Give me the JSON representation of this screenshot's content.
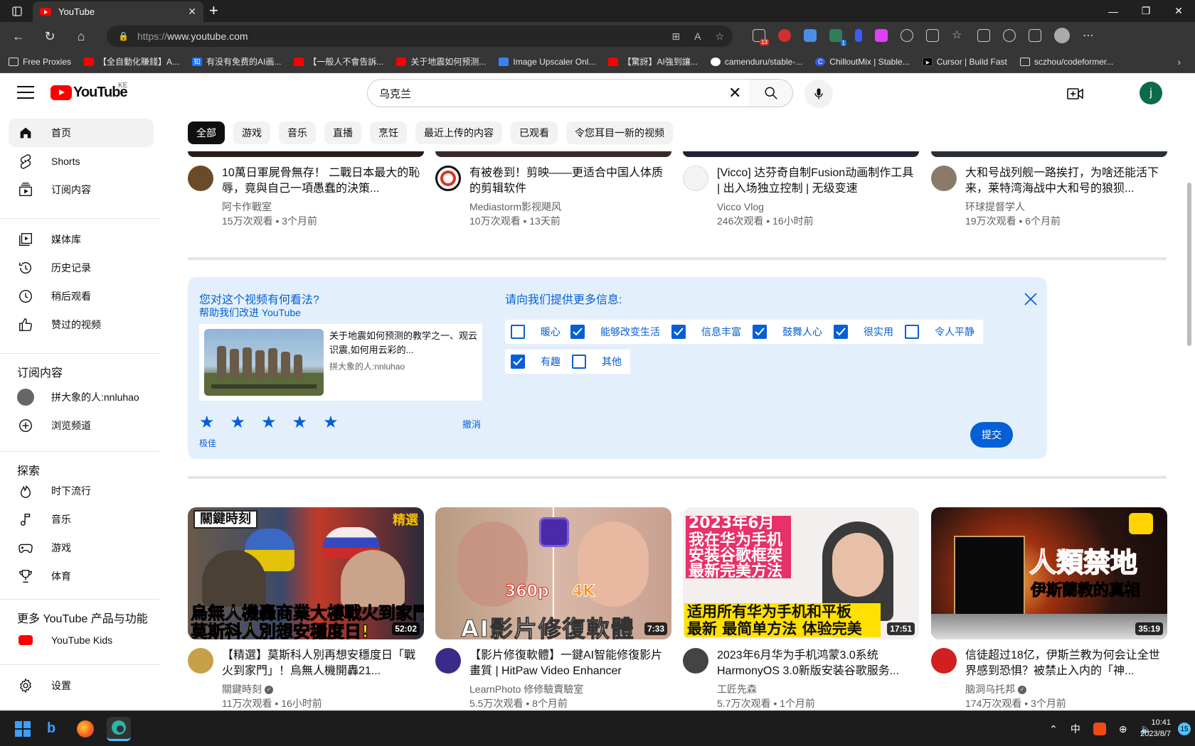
{
  "browser": {
    "tab_title": "YouTube",
    "url_proto": "https://",
    "url_host": "www.youtube.com",
    "bookmarks": [
      {
        "label": "Free Proxies",
        "icon": "document-icon",
        "color": "#ffffff"
      },
      {
        "label": "【全自動化賺錢】A...",
        "icon": "youtube-icon",
        "color": "#ff0000"
      },
      {
        "label": "有没有免费的AI画...",
        "icon": "zhihu-icon",
        "color": "#1772f6"
      },
      {
        "label": "【一般人不會告訴...",
        "icon": "youtube-icon",
        "color": "#ff0000"
      },
      {
        "label": "关于地震如何预测...",
        "icon": "youtube-icon",
        "color": "#ff0000"
      },
      {
        "label": "Image Upscaler Onl...",
        "icon": "upscaler-icon",
        "color": "#3b82f6"
      },
      {
        "label": "【驚訝】AI強到讓...",
        "icon": "youtube-icon",
        "color": "#ff0000"
      },
      {
        "label": "camenduru/stable-...",
        "icon": "github-icon",
        "color": "#ffffff"
      },
      {
        "label": "ChilloutMix | Stable...",
        "icon": "civitai-icon",
        "color": "#3b5bdb"
      },
      {
        "label": "Cursor | Build Fast",
        "icon": "cursor-icon",
        "color": "#000000"
      },
      {
        "label": "sczhou/codeformer...",
        "icon": "replicate-icon",
        "color": "#ffffff"
      }
    ]
  },
  "youtube": {
    "logo_text": "YouTube",
    "region": "KE",
    "search_value": "乌克兰",
    "user_initial": "j",
    "sidebar": {
      "main": [
        {
          "label": "首页",
          "icon": "home-icon"
        },
        {
          "label": "Shorts",
          "icon": "shorts-icon"
        },
        {
          "label": "订阅内容",
          "icon": "subscriptions-icon"
        }
      ],
      "library": [
        {
          "label": "媒体库",
          "icon": "library-icon"
        },
        {
          "label": "历史记录",
          "icon": "history-icon"
        },
        {
          "label": "稍后观看",
          "icon": "watch-later-icon"
        },
        {
          "label": "赞过的视频",
          "icon": "liked-icon"
        }
      ],
      "subs_heading": "订阅内容",
      "subs": [
        {
          "label": "拼大象的人:nnluhao",
          "icon": "channel-avatar"
        },
        {
          "label": "浏览频道",
          "icon": "browse-channels-icon"
        }
      ],
      "explore_heading": "探索",
      "explore": [
        {
          "label": "时下流行",
          "icon": "trending-icon"
        },
        {
          "label": "音乐",
          "icon": "music-icon"
        },
        {
          "label": "游戏",
          "icon": "gaming-icon"
        },
        {
          "label": "体育",
          "icon": "sports-icon"
        }
      ],
      "more_heading": "更多 YouTube 产品与功能",
      "more": [
        {
          "label": "YouTube Kids",
          "icon": "youtube-kids-icon"
        }
      ],
      "settings": "设置"
    },
    "chips": [
      "全部",
      "游戏",
      "音乐",
      "直播",
      "烹饪",
      "最近上传的内容",
      "已观看",
      "令您耳目一新的视频"
    ],
    "row1": [
      {
        "title": "10萬日軍屍骨無存！ 二戰日本最大的恥辱，竟與自己一項愚蠢的決策...",
        "channel": "阿卡作戰室",
        "stats": "15万次观看 • 3个月前",
        "avatar_color": "#6b4a2a"
      },
      {
        "title": "有被卷到！剪映——更适合中国人体质的剪辑软件",
        "channel": "Mediastorm影视飓风",
        "stats": "10万次观看 • 13天前",
        "avatar_color": "#ffffff"
      },
      {
        "title": "[Vicco] 达芬奇自制Fusion动画制作工具 | 出入场独立控制 | 无级变速",
        "channel": "Vicco Vlog",
        "stats": "246次观看 • 16小时前",
        "avatar_color": "#f3f3f3"
      },
      {
        "title": "大和号战列舰一路挨打，为啥还能活下来，莱特湾海战中大和号的狼狈...",
        "channel": "环球提督学人",
        "stats": "19万次观看 • 6个月前",
        "avatar_color": "#8a7a6a"
      }
    ],
    "survey": {
      "question": "您对这个视频有何看法?",
      "help": "帮助我们改进 YouTube",
      "video_title": "关于地震如何预测的教学之一、观云识震,如何用云彩的...",
      "video_channel": "拼大象的人:nnluhao",
      "rating": 5,
      "rating_label": "极佳",
      "undo": "撤消",
      "more_info": "请向我们提供更多信息:",
      "options": [
        {
          "label": "暖心",
          "checked": false
        },
        {
          "label": "能够改变生活",
          "checked": true
        },
        {
          "label": "信息丰富",
          "checked": true
        },
        {
          "label": "鼓舞人心",
          "checked": true
        },
        {
          "label": "很实用",
          "checked": true
        },
        {
          "label": "令人平静",
          "checked": false
        },
        {
          "label": "有趣",
          "checked": true
        },
        {
          "label": "其他",
          "checked": false
        }
      ],
      "submit": "提交"
    },
    "row2": [
      {
        "title": "【精選】莫斯科人別再想安穩度日「戰火到家門」！烏無人機開轟21...",
        "channel": "關鍵時刻",
        "verified": true,
        "stats": "11万次观看 • 16小时前",
        "duration": "52:02",
        "cap1": "烏無人機轟商業大樓",
        "cap1b": "戰火到家門",
        "cap2": "莫斯科人別想安穩度日!",
        "badge": "精選",
        "brand": "關鍵時刻",
        "avatar_color": "#c8a04a"
      },
      {
        "title": "【影片修復軟體】一鍵AI智能修復影片畫質 | HitPaw Video Enhancer",
        "channel": "LearnPhoto 修修驗賣驗室",
        "verified": false,
        "stats": "5.5万次观看 • 8个月前",
        "duration": "7:33",
        "cap1": "AI影片修復軟體",
        "res_from": "360p",
        "res_to": "4K",
        "avatar_color": "#3b2a8a"
      },
      {
        "title": "2023年6月华为手机鸿蒙3.0系统HarmonyOS 3.0新版安装谷歌服务...",
        "channel": "工匠先森",
        "verified": false,
        "stats": "5.7万次观看 • 1个月前",
        "duration": "17:51",
        "cap1": "2023年6月",
        "cap2": "我在华为手机",
        "cap3": "安装谷歌框架",
        "cap4": "最新完美方法",
        "cap5": "适用所有华为手机和平板",
        "cap6": "最新 最简单方法 体验完美",
        "avatar_color": "#444444"
      },
      {
        "title": "信徒超过18亿，伊斯兰教为何会让全世界感到恐惧？被禁止入内的「神...",
        "channel": "脑洞乌托邦",
        "verified": true,
        "stats": "174万次观看 • 3个月前",
        "duration": "35:19",
        "cap1": "人類禁地",
        "cap2": "伊斯蘭教的真相",
        "avatar_color": "#d02020"
      }
    ]
  },
  "taskbar": {
    "ime": "中",
    "time": "10:41",
    "date": "2023/8/7",
    "notifications": "15"
  }
}
